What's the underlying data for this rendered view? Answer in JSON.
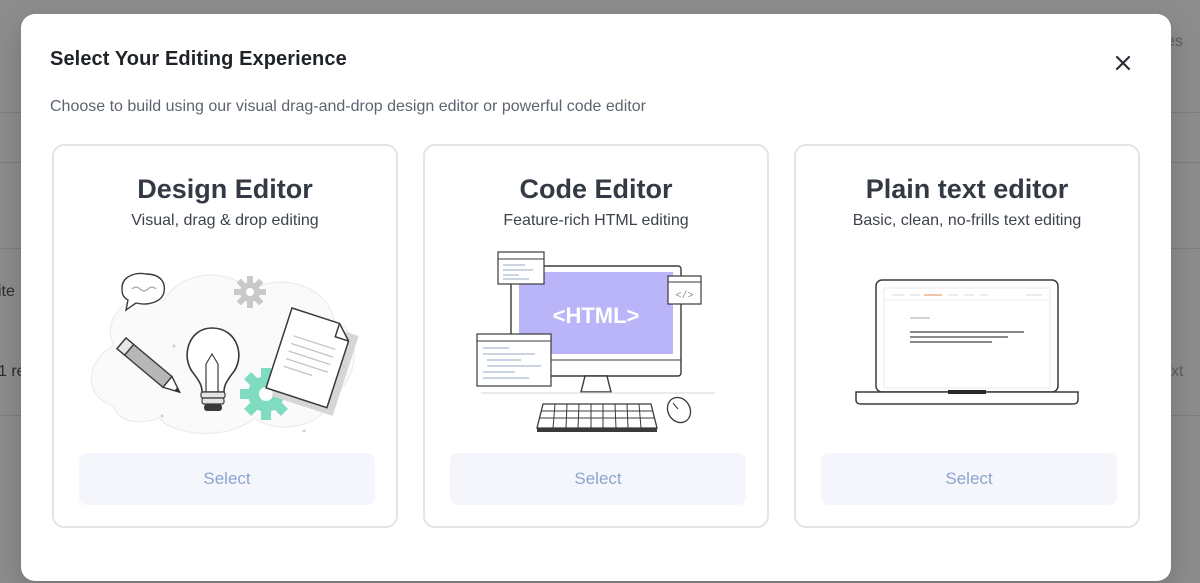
{
  "background": {
    "partial_texts": [
      "es",
      "ite",
      "1 re",
      "xt"
    ]
  },
  "modal": {
    "title": "Select Your Editing Experience",
    "subtitle": "Choose to build using our visual drag-and-drop design editor or powerful code editor",
    "close_icon": "close-icon"
  },
  "cards": [
    {
      "title": "Design Editor",
      "description": "Visual, drag & drop editing",
      "select_label": "Select",
      "illustration": "design-illustration"
    },
    {
      "title": "Code Editor",
      "description": "Feature-rich HTML editing",
      "select_label": "Select",
      "illustration": "code-illustration",
      "illustration_text": "<HTML>",
      "illustration_tag": "</>"
    },
    {
      "title": "Plain text editor",
      "description": "Basic, clean, no-frills text editing",
      "select_label": "Select",
      "illustration": "laptop-illustration"
    }
  ],
  "colors": {
    "overlay": "#8d8d8d",
    "accent_purple": "#b9b5f8",
    "accent_green": "#7fdcc0",
    "button_bg": "#f4f6fb",
    "button_text": "#8ea3cf"
  }
}
